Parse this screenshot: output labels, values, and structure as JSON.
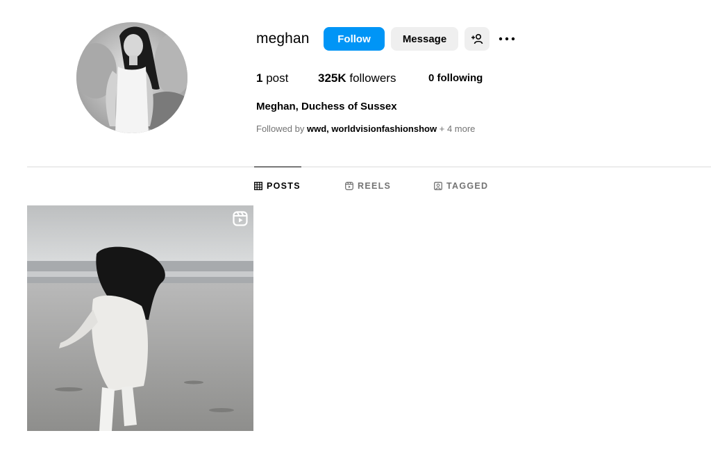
{
  "profile": {
    "username": "meghan",
    "full_name": "Meghan, Duchess of Sussex",
    "avatar": "profile-photo"
  },
  "actions": {
    "follow_label": "Follow",
    "message_label": "Message",
    "suggest_icon": "add-person-icon",
    "more_icon": "more-options-icon"
  },
  "stats": {
    "posts_count": "1",
    "posts_label": "post",
    "followers_count": "325K",
    "followers_label": "followers",
    "following_count": "0",
    "following_label": "following"
  },
  "followed_by": {
    "prefix": "Followed by",
    "account_1": "wwd",
    "separator": ",",
    "account_2": "worldvisionfashionshow",
    "more": "+ 4 more"
  },
  "tabs": [
    {
      "label": "POSTS",
      "icon": "grid-icon",
      "active": true
    },
    {
      "label": "REELS",
      "icon": "reels-icon",
      "active": false
    },
    {
      "label": "TAGGED",
      "icon": "tagged-icon",
      "active": false
    }
  ],
  "posts": [
    {
      "type": "reel",
      "badge_icon": "reels-icon",
      "image": "woman-running-on-beach"
    }
  ],
  "colors": {
    "accent": "#0095f6",
    "secondary_button": "#efefef",
    "muted_text": "#737373",
    "divider": "#dbdbdb"
  }
}
